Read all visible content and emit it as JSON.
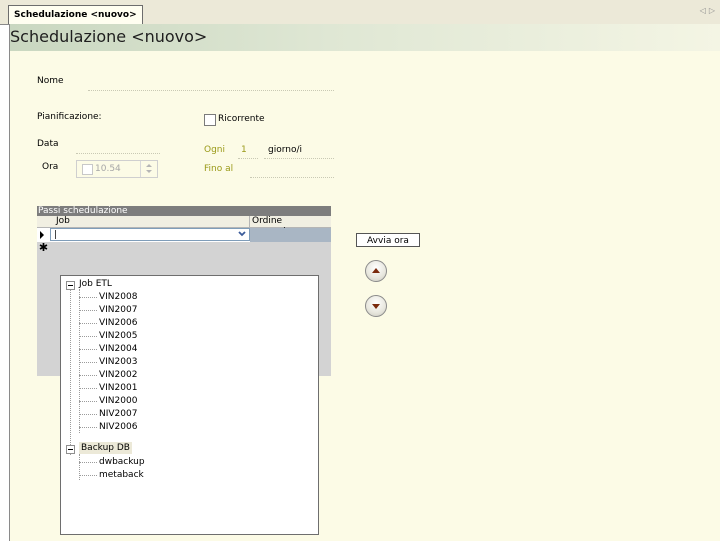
{
  "tab": {
    "label": "Schedulazione <nuovo>"
  },
  "header": {
    "title": "Schedulazione <nuovo>"
  },
  "form": {
    "nome_label": "Nome",
    "nome_value": "",
    "pianificazione_label": "Pianificazione:",
    "ricorrente_label": "Ricorrente",
    "ricorrente_checked": false,
    "data_label": "Data",
    "data_value": "",
    "ora_label": "Ora",
    "ora_value": "10.54",
    "ogni_label": "Ogni",
    "ogni_value": "1",
    "ogni_unit": "giorno/i",
    "fino_label": "Fino al",
    "fino_value": ""
  },
  "grid": {
    "title": "Passi schedulazione",
    "columns": [
      "Job",
      "Ordine esecuzione"
    ],
    "current_input": "|",
    "new_row_marker": "✱"
  },
  "tree": {
    "groups": [
      {
        "label": "Job ETL",
        "children": [
          "VIN2008",
          "VIN2007",
          "VIN2006",
          "VIN2005",
          "VIN2004",
          "VIN2003",
          "VIN2002",
          "VIN2001",
          "VIN2000",
          "NIV2007",
          "NIV2006"
        ]
      },
      {
        "label": "Backup DB",
        "children": [
          "dwbackup",
          "metaback"
        ]
      }
    ]
  },
  "buttons": {
    "run_now": "Avvia ora"
  },
  "icons": [
    "triangle-up-icon",
    "triangle-down-icon",
    "chevron-down-icon",
    "row-pointer-icon",
    "new-row-icon",
    "collapse-icon",
    "tab-scroll-left-icon",
    "tab-scroll-right-icon"
  ],
  "colors": {
    "panel_bg": "#fcfbe6",
    "field_label_accent": "#9a9a18",
    "grid_header": "#7d7d7d",
    "selected_cell": "#a9b6c4"
  }
}
